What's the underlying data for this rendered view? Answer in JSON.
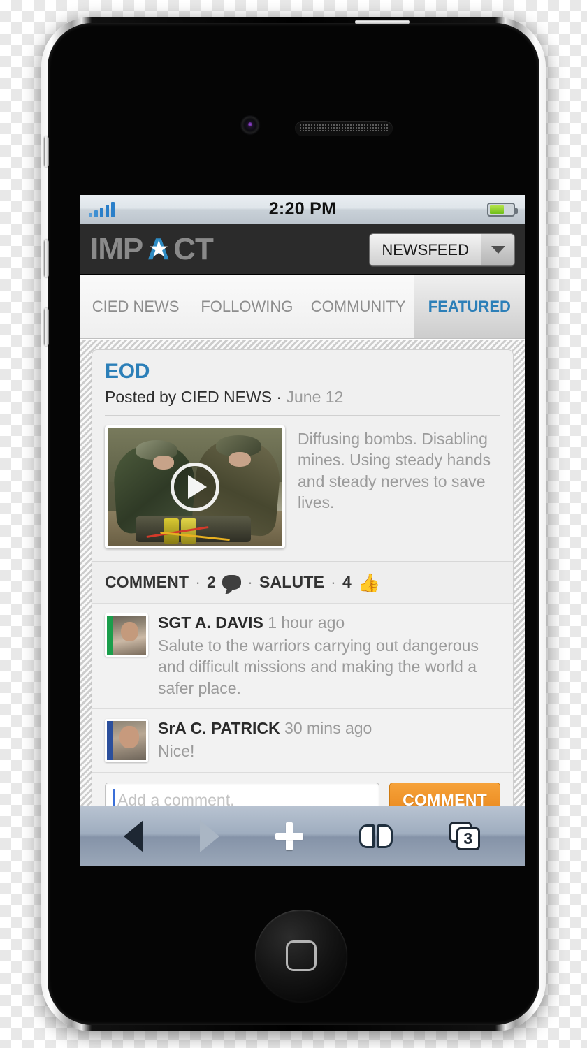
{
  "status_bar": {
    "time": "2:20 PM",
    "signal_icon": "signal-bars-icon",
    "signal_bars": 5,
    "battery_icon": "battery-icon",
    "battery_level_pct": 62
  },
  "app_header": {
    "logo_part1": "IMP",
    "logo_star_letter": "A",
    "logo_star_icon": "star-icon",
    "logo_part2": "CT",
    "feed_selector": {
      "label": "NEWSFEED",
      "caret_icon": "chevron-down-icon"
    }
  },
  "tabs": [
    {
      "label": "CIED NEWS",
      "active": false
    },
    {
      "label": "FOLLOWING",
      "active": false
    },
    {
      "label": "COMMUNITY",
      "active": false
    },
    {
      "label": "FEATURED",
      "active": true
    }
  ],
  "post": {
    "title": "EOD",
    "posted_by_prefix": "Posted by",
    "author": "CIED NEWS",
    "separator": "·",
    "date": "June 12",
    "description": "Diffusing bombs. Disabling mines. Using steady hands and steady nerves to save lives.",
    "media": {
      "type": "video-thumbnail",
      "play_icon": "play-button-icon",
      "alt": "Two soldiers in camouflage defusing an improvised explosive device"
    },
    "actions": {
      "comment_label": "COMMENT",
      "comment_count": "2",
      "comment_icon": "speech-bubble-icon",
      "salute_label": "SALUTE",
      "salute_count": "4",
      "salute_icon": "thumbs-up-icon",
      "dot": "·"
    }
  },
  "comments": [
    {
      "avatar_icon": "avatar",
      "name": "SGT A. DAVIS",
      "time": "1 hour ago",
      "text": "Salute to the warriors carrying out dangerous and difficult missions and making the world a safer place."
    },
    {
      "avatar_icon": "avatar",
      "name": "SrA C. PATRICK",
      "time": "30 mins ago",
      "text": "Nice!"
    }
  ],
  "comment_form": {
    "placeholder": "Add a comment.",
    "value": "",
    "submit_label": "COMMENT"
  },
  "browser_toolbar": {
    "back_icon": "back-arrow-icon",
    "forward_icon": "forward-arrow-icon",
    "share_icon": "plus-icon",
    "bookmarks_icon": "book-icon",
    "tabs_icon": "tabs-icon",
    "tabs_count": "3"
  },
  "colors": {
    "accent_blue": "#2c7fb8",
    "accent_orange": "#e8861b",
    "header_dark": "#2b2b2b",
    "muted_text": "#9b9b9b"
  }
}
